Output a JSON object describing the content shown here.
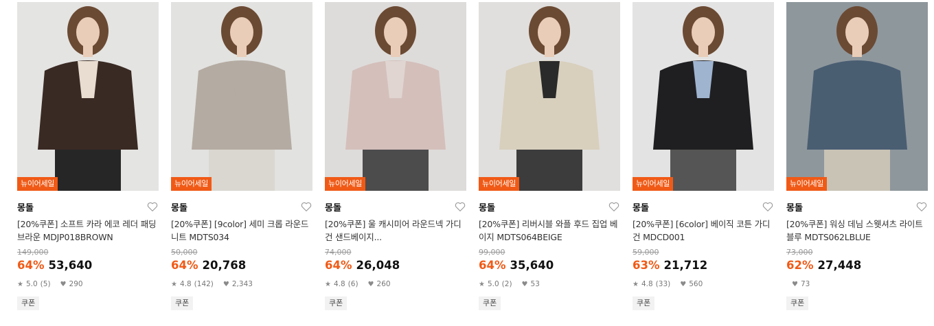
{
  "products": [
    {
      "badge": "뉴이어세일",
      "brand": "몽돌",
      "title": "[20%쿠폰] 소프트 카라 에코 레더 패딩 브라운 MDJP018BROWN",
      "original_price": "149,000",
      "discount": "64%",
      "price": "53,640",
      "rating": "5.0",
      "review_count": "(5)",
      "likes": "290",
      "coupon": "쿠폰",
      "colors": {
        "bg": "#e4e4e2",
        "top": "#3a2a24",
        "bottom": "#262626",
        "inner": "#e8ddd0"
      }
    },
    {
      "badge": "뉴이어세일",
      "brand": "몽돌",
      "title": "[20%쿠폰] [9color] 세미 크롭 라운드 니트 MDTS034",
      "original_price": "50,000",
      "discount": "64%",
      "price": "20,768",
      "rating": "4.8",
      "review_count": "(142)",
      "likes": "2,343",
      "coupon": "쿠폰",
      "colors": {
        "bg": "#e2e2e0",
        "top": "#b4aba2",
        "bottom": "#d9d7d0",
        "inner": "#b4aba2"
      }
    },
    {
      "badge": "뉴이어세일",
      "brand": "몽돌",
      "title": "[20%쿠폰] 울 캐시미어 라운드넥 가디건 샌드베이지...",
      "original_price": "74,000",
      "discount": "64%",
      "price": "26,048",
      "rating": "4.8",
      "review_count": "(6)",
      "likes": "260",
      "coupon": "쿠폰",
      "colors": {
        "bg": "#dedcda",
        "top": "#d4bfbb",
        "bottom": "#4c4c4c",
        "inner": "#e0d5d1"
      }
    },
    {
      "badge": "뉴이어세일",
      "brand": "몽돌",
      "title": "[20%쿠폰] 리버시블 와플 후드 집업 베이지 MDTS064BEIGE",
      "original_price": "99,000",
      "discount": "64%",
      "price": "35,640",
      "rating": "5.0",
      "review_count": "(2)",
      "likes": "53",
      "coupon": "쿠폰",
      "colors": {
        "bg": "#e0dfdd",
        "top": "#d8cfbd",
        "bottom": "#3c3c3c",
        "inner": "#2a2a2a"
      }
    },
    {
      "badge": "뉴이어세일",
      "brand": "몽돌",
      "title": "[20%쿠폰] [6color] 베이직 코튼 가디건 MDCD001",
      "original_price": "59,000",
      "discount": "63%",
      "price": "21,712",
      "rating": "4.8",
      "review_count": "(33)",
      "likes": "560",
      "coupon": "쿠폰",
      "colors": {
        "bg": "#e3e3e3",
        "top": "#1f1f22",
        "bottom": "#555555",
        "inner": "#9fb4cf"
      }
    },
    {
      "badge": "뉴이어세일",
      "brand": "몽돌",
      "title": "[20%쿠폰] 워싱 데님 스웻셔츠 라이트블루 MDTS062LBLUE",
      "original_price": "73,000",
      "discount": "62%",
      "price": "27,448",
      "rating": "",
      "review_count": "",
      "likes": "73",
      "coupon": "쿠폰",
      "colors": {
        "bg": "#8e979c",
        "top": "#4a5e72",
        "bottom": "#c9c3b6",
        "inner": "#4a5e72"
      }
    }
  ]
}
